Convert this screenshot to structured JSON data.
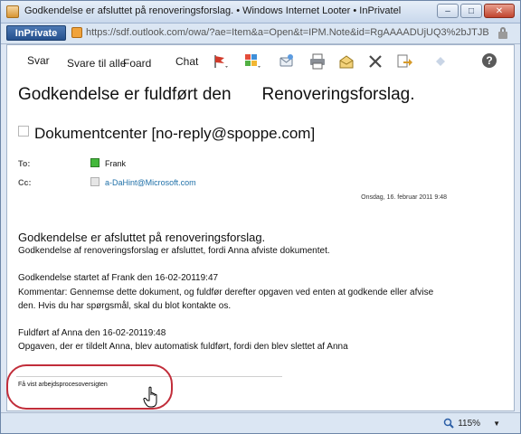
{
  "window": {
    "title": "Godkendelse er afsluttet på renoveringsforslag. • Windows Internet Looter • InPrivatel",
    "controls": [
      "–",
      "□",
      "✕"
    ]
  },
  "address_bar": {
    "inprivate_label": "InPrivate",
    "url": "https://sdf.outlook.com/owa/?ae=Item&a=Open&t=IPM.Note&id=RgAAAADUjUQ3%2bJTJBdVM"
  },
  "toolbar": {
    "reply": "Svar",
    "reply_all": "Svare til alle",
    "forward": "Foard",
    "chat": "Chat",
    "icons": [
      "flag-icon",
      "categories-icon",
      "move-icon",
      "print-icon",
      "mark-read-icon",
      "delete-icon",
      "move-to-folder-icon",
      "navigate-icon",
      "help-icon"
    ],
    "colors": {
      "flag": "#d13a2a",
      "help": "#5a5a5a"
    }
  },
  "message": {
    "title_part1": "Godkendelse er fuldført den",
    "title_part2": "Renoveringsforslag.",
    "sender": "Dokumentcenter [no-reply@spoppe.com]",
    "to_label": "To:",
    "to_value": "Frank",
    "cc_label": "Cc:",
    "cc_value": "a-DaHint@Microsoft.com",
    "date": "Onsdag, 16. februar 2011 9:48"
  },
  "body": {
    "heading": "Godkendelse er afsluttet på renoveringsforslag.",
    "line1": "Godkendelse af renoveringsforslag er afsluttet, fordi Anna afviste dokumentet.",
    "started": "Godkendelse startet af Frank den 16-02-20119:47",
    "comment1": "Kommentar: Gennemse dette dokument, og fuldfør derefter opgaven ved enten at godkende eller afvise",
    "comment2": "den. Hvis du har spørgsmål, skal du blot kontakte os.",
    "completed": "Fuldført af Anna den 16-02-20119:48",
    "completed2": "Opgaven, der er tildelt Anna, blev automatisk fuldført, fordi den blev slettet af Anna",
    "workflow_link": "Få vist arbejdsprocesoversigten"
  },
  "status_bar": {
    "zoom": "115%"
  }
}
